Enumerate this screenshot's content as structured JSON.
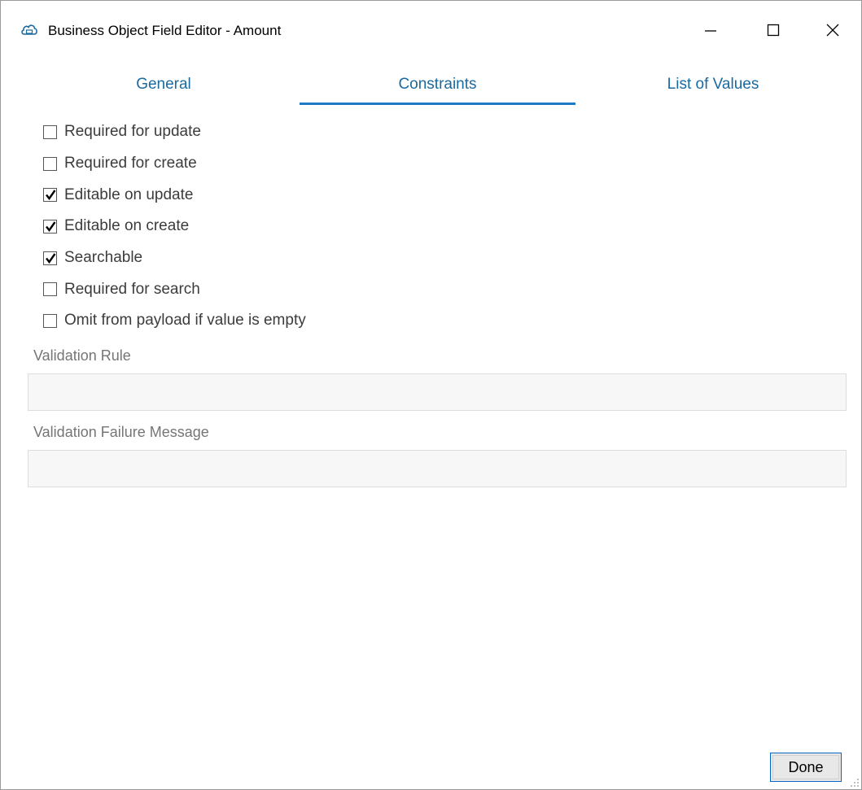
{
  "window": {
    "title": "Business Object Field Editor - Amount",
    "minimize_glyph": "—",
    "maximize_glyph": "☐",
    "close_glyph": "✕",
    "icon": "cloud-icon"
  },
  "tabs": [
    {
      "label": "General",
      "active": false
    },
    {
      "label": "Constraints",
      "active": true
    },
    {
      "label": "List of Values",
      "active": false
    }
  ],
  "constraints": [
    {
      "label": "Required for update",
      "checked": false
    },
    {
      "label": "Required for create",
      "checked": false
    },
    {
      "label": "Editable on update",
      "checked": true
    },
    {
      "label": "Editable on create",
      "checked": true
    },
    {
      "label": "Searchable",
      "checked": true
    },
    {
      "label": "Required for search",
      "checked": false
    },
    {
      "label": "Omit from payload if value is empty",
      "checked": false
    }
  ],
  "validation_rule": {
    "label": "Validation Rule",
    "value": ""
  },
  "validation_failure_message": {
    "label": "Validation Failure Message",
    "value": ""
  },
  "footer": {
    "done_label": "Done"
  },
  "colors": {
    "accent": "#1c7bc4",
    "tab_text": "#1a6aa0",
    "field_bg": "#f7f7f7",
    "done_border": "#0a64c8"
  }
}
